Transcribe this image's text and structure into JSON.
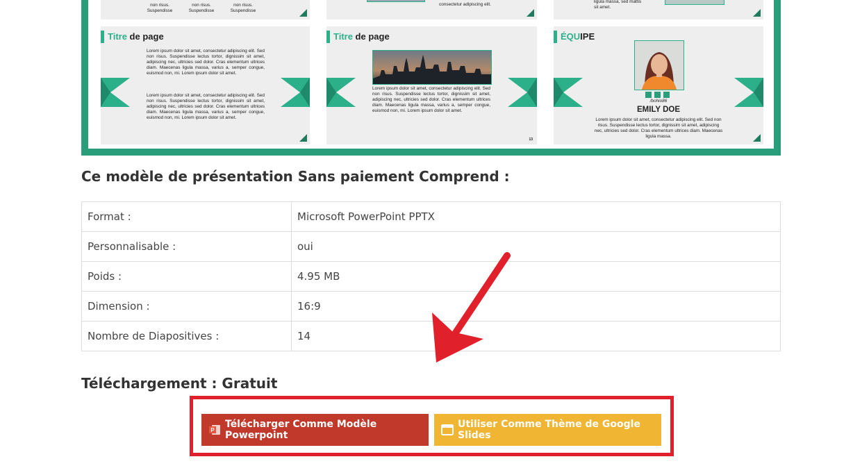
{
  "slides": {
    "top_texts": {
      "s1": "non risus.\nSuspendisse",
      "s2": "consectetur adipiscing elit.",
      "s3": "ligula massa, sed mattis\nsit amet."
    },
    "s1": {
      "title_accent": "Titre",
      "title_rest": " de page",
      "para1": "Lorem ipsum dolor sit amet, consectetur adipiscing elit. Sed non risus. Suspendisse lectus tortor, dignissim sit amet, adipiscing nec, ultricies sed dolor. Cras elementum ultrices diam. Maecenas ligula massa, varius a, semper congue, euismod non, mi. Lorem ipsum dolor sit amet.",
      "para2": "Lorem ipsum dolor sit amet, consectetur adipiscing elit. Sed non risus. Suspendisse lectus tortor, dignissim sit amet, adipiscing nec, ultricies sed dolor. Cras elementum ultrices diam. Maecenas ligula massa, varius a, semper congue, euismod non, mi. Lorem ipsum dolor sit amet."
    },
    "s2": {
      "title_accent": "Titre",
      "title_rest": " de page",
      "para": "Lorem ipsum dolor sit amet, consectetur adipiscing elit. Sed non risus. Suspendisse lectus tortor, dignissim sit amet, adipiscing nec, ultricies sed dolor. Cras elementum ultrices diam. Maecenas ligula massa, varius a, semper congue, euismod non, mi. Lorem ipsum dolor sit amet.",
      "page_number": "13"
    },
    "s3": {
      "title_accent": "ÉQU",
      "title_rest": "IPE",
      "handle": "/bohio86",
      "name": "EMILY DOE",
      "para": "Lorem ipsum dolor sit amet, consectetur adipiscing elit. Sed non risus. Suspendisse lectus tortor, dignissim sit amet, adipiscing nec, ultricies sed dolor. Cras elementum ultrices diam. Maecenas ligula massa."
    }
  },
  "includes_heading": "Ce modèle de présentation Sans paiement Comprend :",
  "specs": [
    {
      "label": "Format :",
      "value": "Microsoft PowerPoint PPTX"
    },
    {
      "label": "Personnalisable :",
      "value": "oui"
    },
    {
      "label": "Poids :",
      "value": "4.95 MB"
    },
    {
      "label": "Dimension :",
      "value": "16:9"
    },
    {
      "label": "Nombre de Diapositives :",
      "value": "14"
    }
  ],
  "download_heading": "Téléchargement : Gratuit",
  "buttons": {
    "powerpoint_label": "Télécharger Comme Modèle Powerpoint",
    "google_slides_label": "Utiliser Comme Thème de Google Slides"
  },
  "colors": {
    "frame": "#2a9d7a",
    "accent": "#2bb08a",
    "ppt_button": "#c0392b",
    "gs_button": "#f0b532",
    "highlight": "#e0202a"
  },
  "icons": [
    "powerpoint-icon",
    "google-slides-icon",
    "arrow-left-icon",
    "arrow-right-icon",
    "linkedin-icon",
    "facebook-icon",
    "twitter-icon"
  ]
}
